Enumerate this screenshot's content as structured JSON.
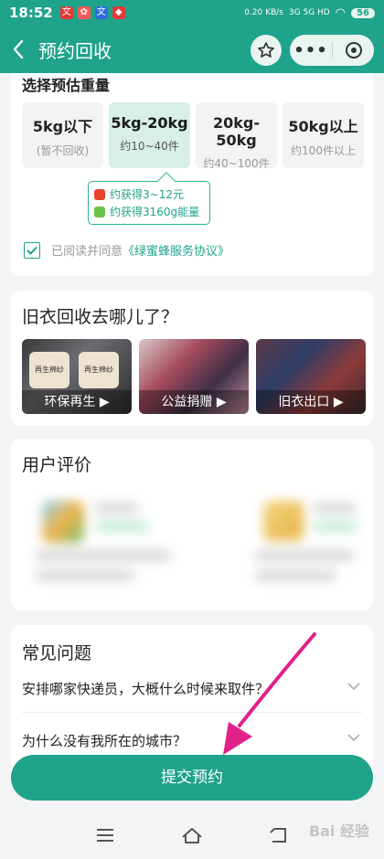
{
  "status_bar": {
    "time": "18:52",
    "net_speed": "0.20 KB/s",
    "signal": "3G 5G HD",
    "battery": "56"
  },
  "nav": {
    "title": "预约回收"
  },
  "weight": {
    "section_title": "选择预估重量",
    "options": [
      {
        "label": "5kg以下",
        "sub": "(暂不回收)"
      },
      {
        "label": "5kg-20kg",
        "sub": "约10~40件"
      },
      {
        "label": "20kg-50kg",
        "sub": "约40~100件"
      },
      {
        "label": "50kg以上",
        "sub": "约100件以上"
      }
    ],
    "selected_index": 1,
    "tooltip": {
      "line1": "约获得3~12元",
      "line2": "约获得3160g能量"
    },
    "agree_text": "已阅读并同意",
    "agree_link": "《绿蜜蜂服务协议》"
  },
  "where": {
    "title": "旧衣回收去哪儿了？",
    "tiles": [
      {
        "label": "环保再生 ▶",
        "spool_text": "再生棉纱"
      },
      {
        "label": "公益捐赠 ▶"
      },
      {
        "label": "旧衣出口 ▶"
      }
    ]
  },
  "reviews": {
    "title": "用户评价"
  },
  "faq": {
    "title": "常见问题",
    "items": [
      "安排哪家快递员，大概什么时候来取件？",
      "为什么没有我所在的城市？"
    ]
  },
  "submit": {
    "label": "提交预约"
  },
  "watermark": "Bai 经验",
  "colors": {
    "brand": "#1fa38a",
    "annotation_arrow": "#e0218a"
  }
}
